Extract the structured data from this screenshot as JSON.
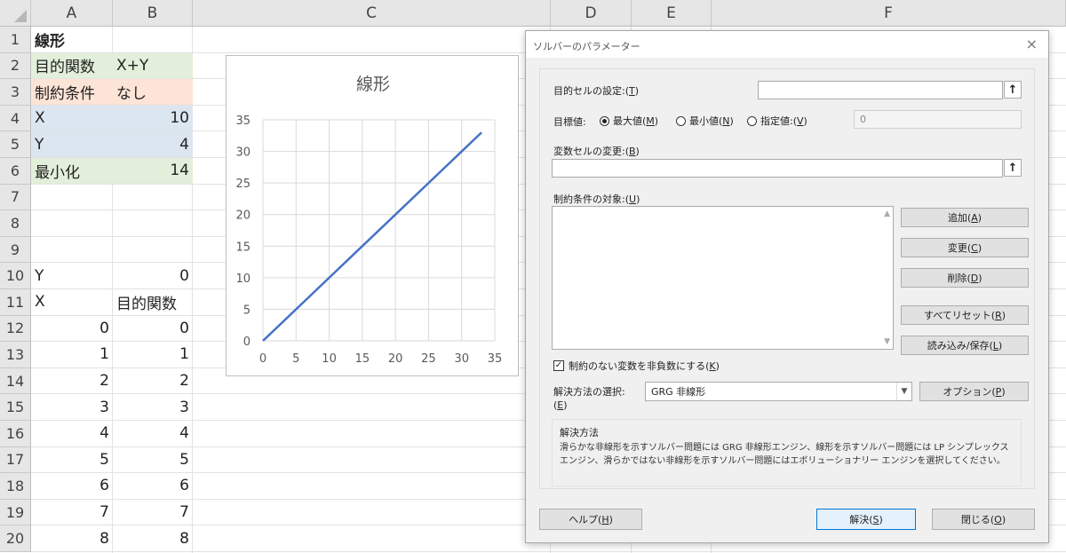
{
  "columns": [
    "A",
    "B",
    "C",
    "D",
    "E",
    "F"
  ],
  "rows": [
    {
      "num": "1",
      "a": "線形",
      "b": ""
    },
    {
      "num": "2",
      "a": "目的関数",
      "b": "X+Y"
    },
    {
      "num": "3",
      "a": "制約条件",
      "b": "なし"
    },
    {
      "num": "4",
      "a": "X",
      "b": "10"
    },
    {
      "num": "5",
      "a": "Y",
      "b": "4"
    },
    {
      "num": "6",
      "a": "最小化",
      "b": "14"
    },
    {
      "num": "7",
      "a": "",
      "b": ""
    },
    {
      "num": "8",
      "a": "",
      "b": ""
    },
    {
      "num": "9",
      "a": "",
      "b": ""
    },
    {
      "num": "10",
      "a": "Y",
      "b": "0"
    },
    {
      "num": "11",
      "a": "X",
      "b": "目的関数"
    },
    {
      "num": "12",
      "a": "0",
      "b": "0"
    },
    {
      "num": "13",
      "a": "1",
      "b": "1"
    },
    {
      "num": "14",
      "a": "2",
      "b": "2"
    },
    {
      "num": "15",
      "a": "3",
      "b": "3"
    },
    {
      "num": "16",
      "a": "4",
      "b": "4"
    },
    {
      "num": "17",
      "a": "5",
      "b": "5"
    },
    {
      "num": "18",
      "a": "6",
      "b": "6"
    },
    {
      "num": "19",
      "a": "7",
      "b": "7"
    },
    {
      "num": "20",
      "a": "8",
      "b": "8"
    }
  ],
  "fills": {
    "row2": "#e2efda",
    "row3": "#fce4d6",
    "row4": "#dce6f1",
    "row5": "#dce6f1",
    "row6": "#e2efda"
  },
  "chart_data": {
    "type": "line",
    "title": "線形",
    "xlabel": "",
    "ylabel": "",
    "xlim": [
      0,
      35
    ],
    "ylim": [
      0,
      35
    ],
    "xticks": [
      "0",
      "5",
      "10",
      "15",
      "20",
      "25",
      "30",
      "35"
    ],
    "yticks": [
      "0",
      "5",
      "10",
      "15",
      "20",
      "25",
      "30",
      "35"
    ],
    "grid": true,
    "series_color": "#4472c4",
    "x": [
      0,
      33
    ],
    "y": [
      0,
      33
    ]
  },
  "dialog": {
    "title": "ソルバーのパラメーター",
    "close": "×",
    "objective_label": "目的セルの設定:(",
    "objective_key": "T",
    "target_label": "目標値:",
    "radio_max": "最大値(",
    "radio_max_key": "M",
    "radio_min": "最小値(",
    "radio_min_key": "N",
    "radio_value": "指定値:(",
    "radio_value_key": "V",
    "value_field": "0",
    "variable_label": "変数セルの変更:(",
    "variable_key": "B",
    "constraints_label": "制約条件の対象:(",
    "constraints_key": "U",
    "btn_add": "追加(",
    "btn_add_key": "A",
    "btn_change": "変更(",
    "btn_change_key": "C",
    "btn_delete": "削除(",
    "btn_delete_key": "D",
    "btn_reset": "すべてリセット(",
    "btn_reset_key": "R",
    "btn_load": "読み込み/保存(",
    "btn_load_key": "L",
    "nonneg_label": "制約のない変数を非負数にする(",
    "nonneg_key": "K",
    "method_label": "解決方法の選択:",
    "method_key": "E",
    "method_value": "GRG 非線形",
    "btn_options": "オプション(",
    "btn_options_key": "P",
    "desc_title": "解決方法",
    "desc_text": "滑らかな非線形を示すソルバー問題には GRG 非線形エンジン、線形を示すソルバー問題には LP シンプレックス エンジン、滑らかではない非線形を示すソルバー問題にはエボリューショナリー エンジンを選択してください。",
    "btn_help": "ヘルプ(",
    "btn_help_key": "H",
    "btn_solve": "解決(",
    "btn_solve_key": "S",
    "btn_close": "閉じる(",
    "btn_close_key": "O"
  }
}
